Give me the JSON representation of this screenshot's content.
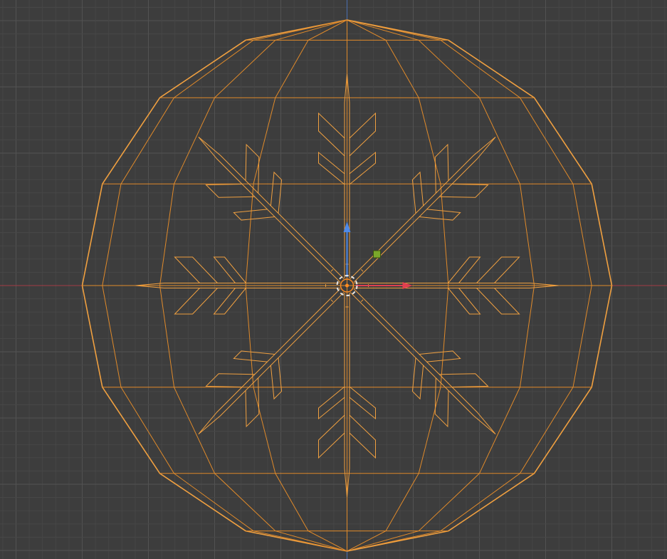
{
  "viewport": {
    "view": "front-orthographic-wireframe",
    "background_color": "#3d3d3d",
    "grid_minor_color": "#474747",
    "grid_major_color": "#525252",
    "x_axis_color": "#a33b45",
    "z_axis_color": "#4a6fb0",
    "wire_color": "#f0a040",
    "wire_inner_color": "#e08a2a"
  },
  "objects": [
    {
      "name": "sphere-ornament",
      "selected": true,
      "wireframe": true,
      "segments": 16,
      "rings": 8
    },
    {
      "name": "snowflake",
      "selected": true,
      "wireframe": true,
      "arms": 8
    }
  ],
  "gizmo": {
    "type": "move",
    "axes": [
      {
        "axis": "x",
        "color": "#e0404f"
      },
      {
        "axis": "z",
        "color": "#4f8ae8"
      },
      {
        "plane": "xz",
        "color": "#7aa82a"
      }
    ],
    "pivot_icon": "3d-cursor-icon"
  }
}
